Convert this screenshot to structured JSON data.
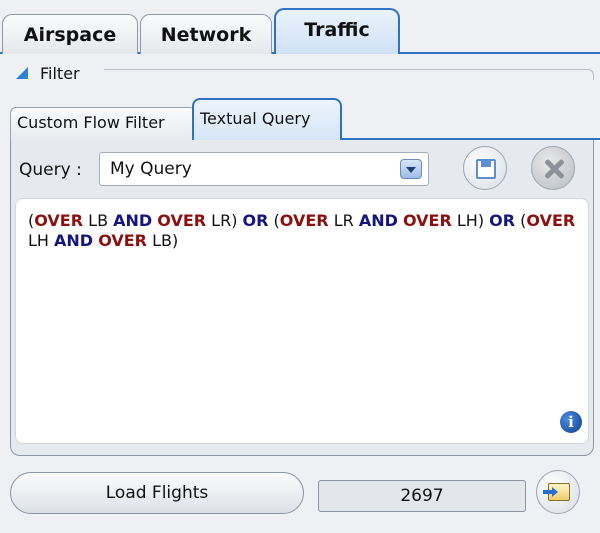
{
  "colors": {
    "keyword_over": "#8b1010",
    "keyword_logic": "#15157e",
    "accent": "#2f72c4"
  },
  "top_tabs": [
    {
      "label": "Airspace",
      "active": false
    },
    {
      "label": "Network",
      "active": false
    },
    {
      "label": "Traffic",
      "active": true
    }
  ],
  "filter": {
    "label": "Filter",
    "expand_icon": "triangle-expanded-icon"
  },
  "sub_tabs": [
    {
      "label": "Custom Flow Filter",
      "active": false
    },
    {
      "label": "Textual Query",
      "active": true
    }
  ],
  "query": {
    "label": "Query :",
    "selected": "My Query",
    "save_icon": "floppy-disk-icon",
    "delete_icon": "close-x-icon",
    "info_icon": "info-icon",
    "text_tokens": [
      {
        "t": "(",
        "type": "plain"
      },
      {
        "t": "OVER",
        "type": "over"
      },
      {
        "t": " LB ",
        "type": "plain"
      },
      {
        "t": "AND",
        "type": "logic"
      },
      {
        "t": " ",
        "type": "plain"
      },
      {
        "t": "OVER",
        "type": "over"
      },
      {
        "t": " LR) ",
        "type": "plain"
      },
      {
        "t": "OR",
        "type": "logic"
      },
      {
        "t": " (",
        "type": "plain"
      },
      {
        "t": "OVER",
        "type": "over"
      },
      {
        "t": " LR ",
        "type": "plain"
      },
      {
        "t": "AND",
        "type": "logic"
      },
      {
        "t": " ",
        "type": "plain"
      },
      {
        "t": "OVER",
        "type": "over"
      },
      {
        "t": " LH) ",
        "type": "plain"
      },
      {
        "t": "OR",
        "type": "logic"
      },
      {
        "t": " (",
        "type": "plain"
      },
      {
        "t": "OVER",
        "type": "over"
      },
      {
        "t": " LH ",
        "type": "plain"
      },
      {
        "t": "AND",
        "type": "logic"
      },
      {
        "t": " ",
        "type": "plain"
      },
      {
        "t": "OVER",
        "type": "over"
      },
      {
        "t": " LB)",
        "type": "plain"
      }
    ]
  },
  "bottom": {
    "load_label": "Load Flights",
    "count": "2697",
    "export_icon": "export-icon"
  }
}
